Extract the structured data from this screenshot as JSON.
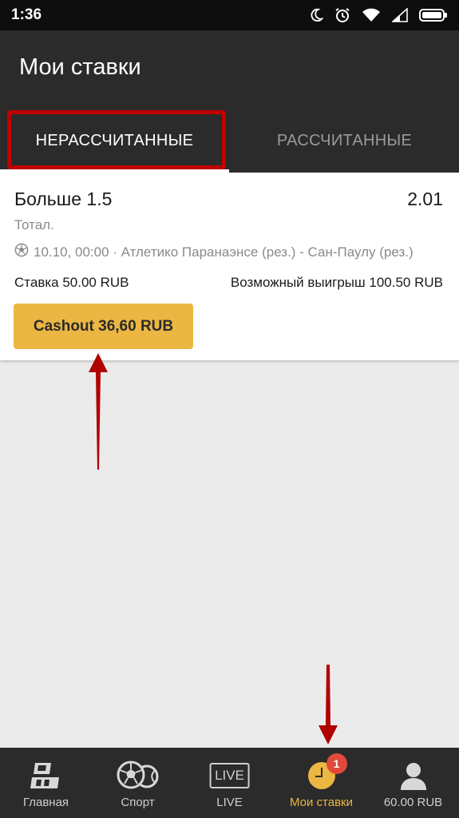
{
  "status_bar": {
    "time": "1:36",
    "icons": [
      "moon-icon",
      "alarm-icon",
      "wifi-icon",
      "signal-icon",
      "battery-icon"
    ]
  },
  "app_bar": {
    "title": "Мои ставки",
    "tabs": [
      {
        "label": "НЕРАССЧИТАННЫЕ",
        "active": true
      },
      {
        "label": "РАССЧИТАННЫЕ",
        "active": false
      }
    ]
  },
  "bet": {
    "name": "Больше 1.5",
    "odds": "2.01",
    "market": "Тотал.",
    "event": "10.10, 00:00 · Атлетико Паранаэнсе (рез.) - Сан-Паулу (рез.)",
    "stake": "Ставка 50.00 RUB",
    "potential_win": "Возможный выигрыш 100.50 RUB",
    "cashout_label": "Cashout 36,60 RUB"
  },
  "bottom_nav": {
    "items": [
      {
        "label": "Главная",
        "icon": "pm-logo-icon"
      },
      {
        "label": "Спорт",
        "icon": "sports-balls-icon"
      },
      {
        "label": "LIVE",
        "icon": "live-icon",
        "icon_text": "LIVE"
      },
      {
        "label": "Мои ставки",
        "icon": "clock-icon",
        "badge": "1",
        "active": true
      },
      {
        "label": "60.00 RUB",
        "icon": "user-icon"
      }
    ]
  },
  "colors": {
    "accent": "#ecb642",
    "header_bg": "#2b2b2b",
    "annotation_red": "#c00000",
    "badge_red": "#e04a3a"
  }
}
